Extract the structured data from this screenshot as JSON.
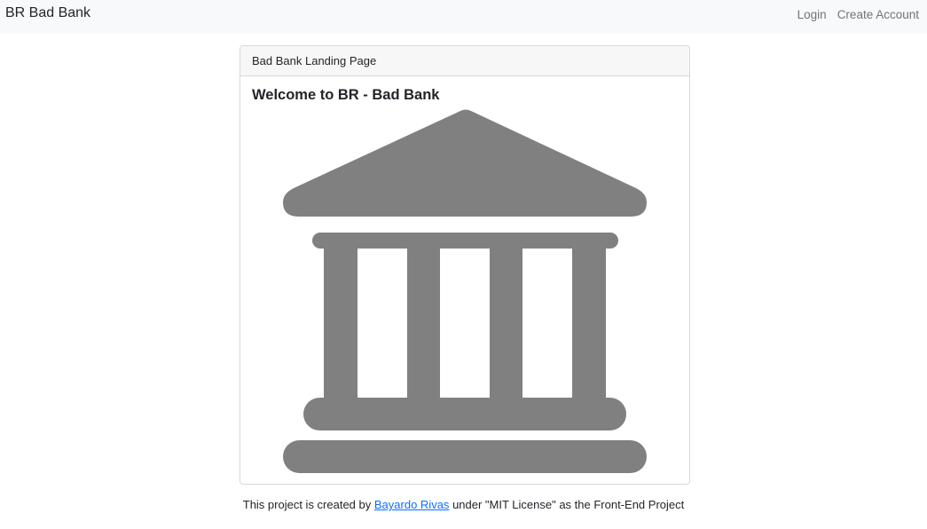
{
  "navbar": {
    "brand": "BR Bad Bank",
    "links": [
      {
        "label": "Login"
      },
      {
        "label": "Create Account"
      }
    ]
  },
  "card": {
    "header": "Bad Bank Landing Page",
    "title": "Welcome to BR - Bad Bank",
    "icon": "bank-icon",
    "icon_color": "#808080"
  },
  "footer": {
    "prefix": "This project is created by",
    "author_link": "Bayardo Rivas",
    "suffix": "under \"MIT License\" as the Front-End Project",
    "link_color": "#0d6efd"
  }
}
